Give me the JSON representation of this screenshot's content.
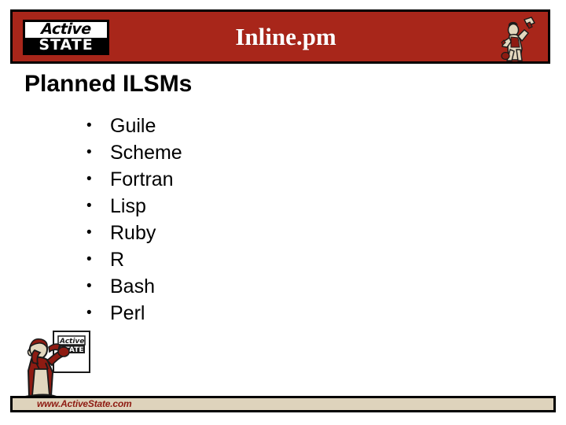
{
  "header": {
    "title": "Inline.pm",
    "logo": {
      "line1": "Active",
      "line2": "STATE"
    },
    "worker_icon": "worker-with-hammer-icon",
    "bar_color": "#A8261A",
    "border_color": "#000000"
  },
  "slide": {
    "heading": "Planned ILSMs",
    "bullets": [
      {
        "label": "Guile",
        "marker": "•"
      },
      {
        "label": "Scheme",
        "marker": "•"
      },
      {
        "label": "Fortran",
        "marker": "•"
      },
      {
        "label": "Lisp",
        "marker": "•"
      },
      {
        "label": "Ruby",
        "marker": "•"
      },
      {
        "label": "R",
        "marker": "•"
      },
      {
        "label": "Bash",
        "marker": "•"
      },
      {
        "label": "Perl",
        "marker": "•"
      }
    ]
  },
  "footer": {
    "url": "www.ActiveState.com",
    "bar_color": "#DED3BC",
    "url_color": "#8E1B12",
    "worker_icon": "worker-holding-poster-icon",
    "poster_text_line1": "Active",
    "poster_text_line2": "STATE"
  }
}
